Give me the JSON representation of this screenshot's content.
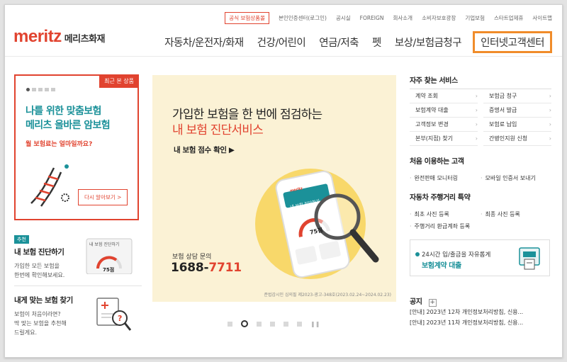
{
  "util_links": [
    "공식 보험상품몰",
    "본인인증센터(로그인)",
    "공시실",
    "FOREIGN",
    "회사소개",
    "소비자보호광장",
    "기업보험",
    "스타트업제휴",
    "사이트맵"
  ],
  "logo": {
    "en": "meritz",
    "kr": "메리츠화재"
  },
  "gnb": [
    "자동차/운전자/화재",
    "건강/어린이",
    "연금/저축",
    "펫",
    "보상/보험금청구",
    "인터넷고객센터"
  ],
  "recent": {
    "tag": "최근 본 상품",
    "title1": "나를 위한 맞춤보험",
    "title2": "메리츠 올바른 암보험",
    "sub": "월 보험료는 얼마일까요?",
    "button": "다시 알아보기 >"
  },
  "side1": {
    "badge": "추천",
    "title": "내 보험 진단하기",
    "desc1": "가입한 모든 보험을",
    "desc2": "한번에 확인해보세요.",
    "card": "내 보험 진단하기",
    "score": "75점"
  },
  "side2": {
    "title": "내게 맞는 보험 찾기",
    "desc1": "보험이 처음이라면?",
    "desc2": "딱 맞는 보험을 추천해",
    "desc3": "드릴게요."
  },
  "banner": {
    "title": "가입한 보험을 한 번에 점검하는",
    "title_red": "내 보험 진단서비스",
    "check": "내 보험 점수 확인 ▶",
    "consult": "보험 상담 문의",
    "phone_a": "1688-",
    "phone_b": "7711",
    "fine": "준법감시인 심의필 제2023-광고-348호(2023.02.24~2024.02.23)",
    "phone_screen_brand": "meritz",
    "phone_screen_title": "내 보험 진단하기",
    "phone_screen_score": "75점"
  },
  "services": {
    "title": "자주 찾는 서비스",
    "items": [
      "계약 조회",
      "보험금 청구",
      "보험계약 대출",
      "증명서 발급",
      "고객정보 변경",
      "보험료 납입",
      "본부(지점) 찾기",
      "간병인지원 신청"
    ]
  },
  "first_time": {
    "title": "처음 이용하는 고객",
    "items": [
      "완전판매 모니터링",
      "모바일 인증서 보내기"
    ]
  },
  "auto": {
    "title": "자동차 주행거리 특약",
    "items": [
      "최초 사진 등록",
      "최종 사진 등록",
      "주행거리 환급계좌 등록"
    ]
  },
  "loan": {
    "line1": "24시간 입/출금을 자유롭게",
    "line2": "보험계약 대출"
  },
  "notice": {
    "title": "공지",
    "plus": "+",
    "items": [
      "[안내] 2023년 12차 개인정보처리방침, 신용...",
      "[안내] 2023년 11차 개인정보처리방침, 신용..."
    ]
  },
  "colors": {
    "brand_red": "#e1432f",
    "teal": "#1b9199",
    "highlight": "#f08c2a"
  }
}
